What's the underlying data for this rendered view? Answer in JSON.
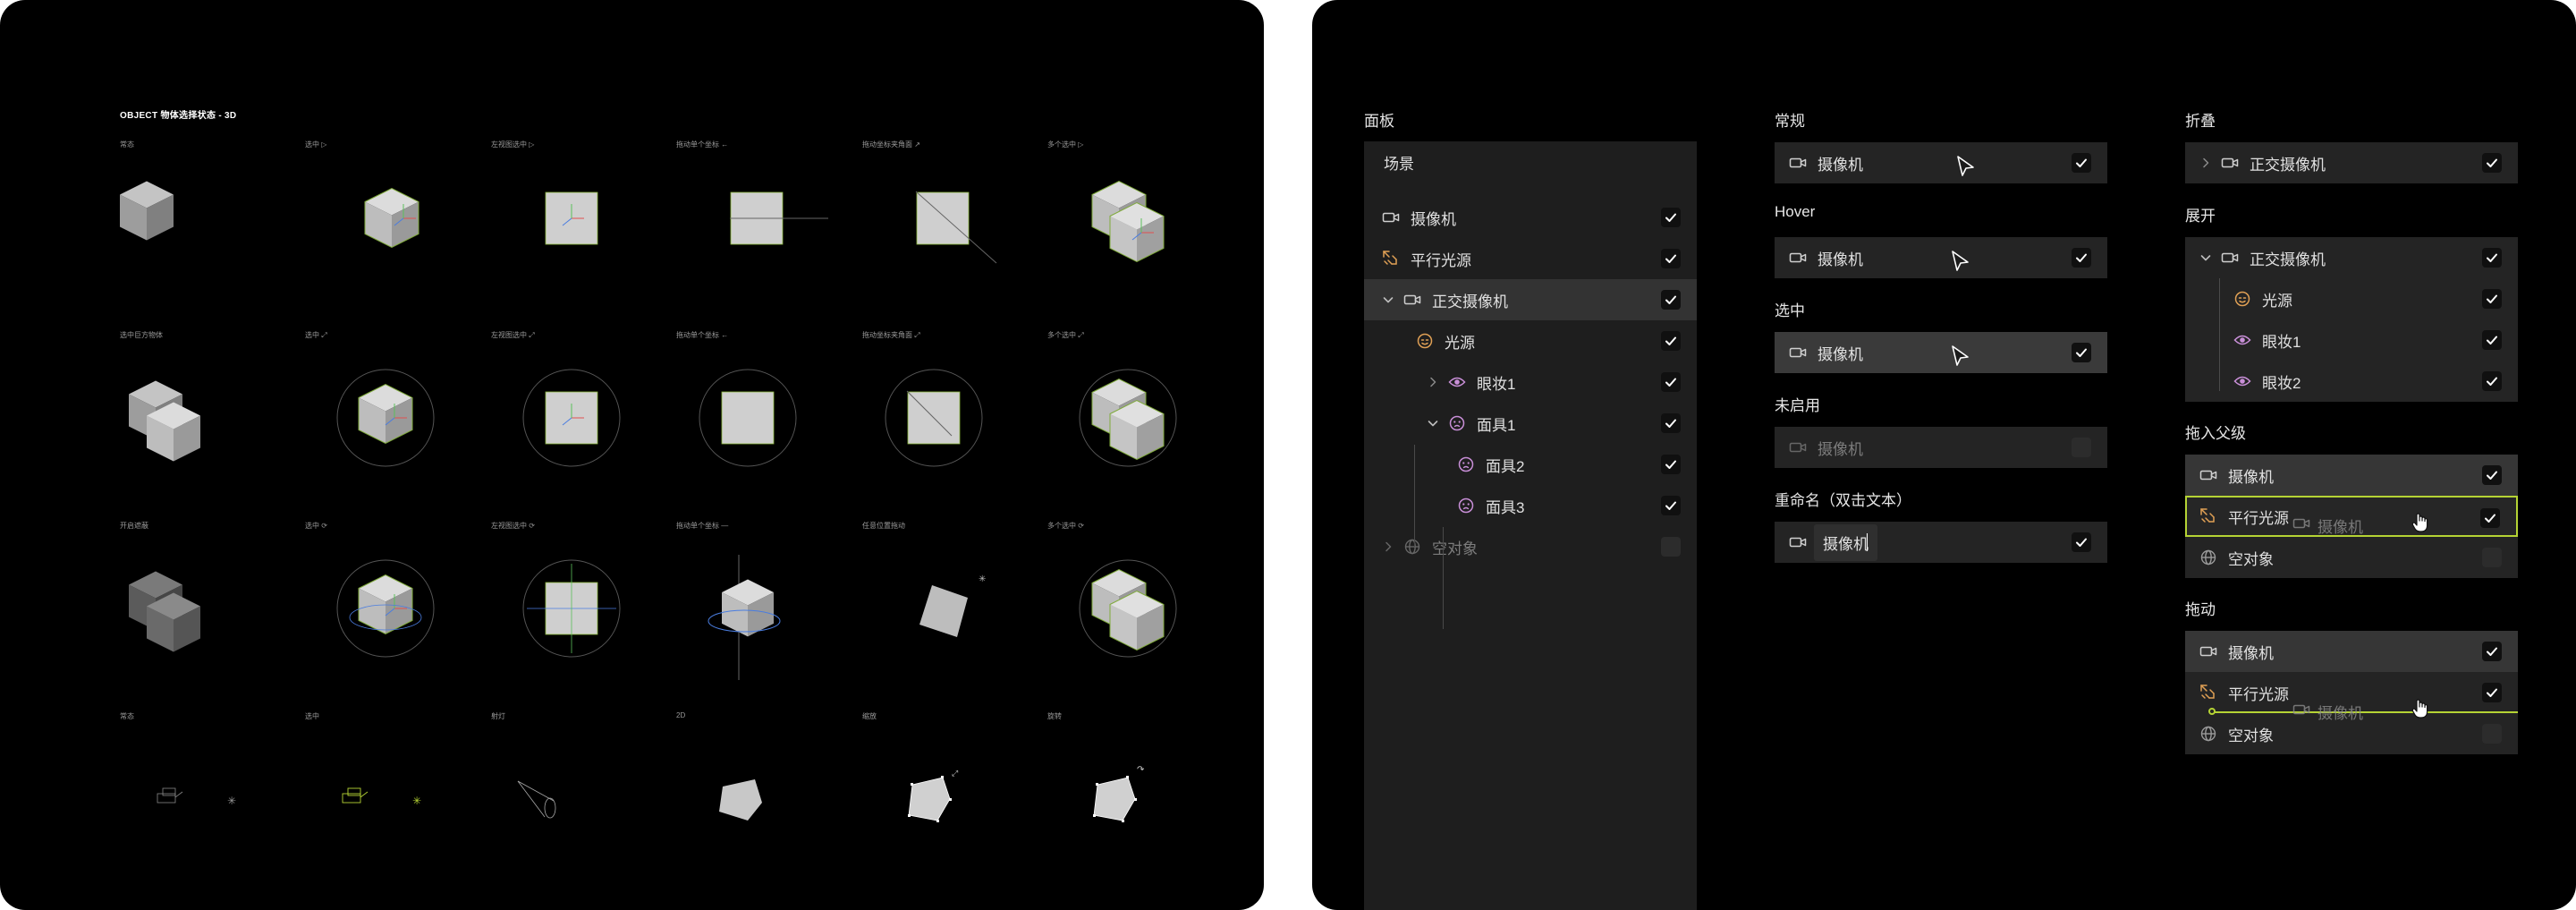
{
  "left": {
    "title": "OBJECT 物体选择状态 - 3D",
    "rows": [
      [
        "常态",
        "选中 ▷",
        "左视图选中 ▷",
        "拖动单个坐标 ←",
        "拖动坐标夹角面 ↗",
        "多个选中 ▷"
      ],
      [
        "选中巨方物体",
        "选中 ⤢",
        "左视图选中 ⤢",
        "拖动单个坐标 ←",
        "拖动坐标夹角面 ⤢",
        "多个选中 ⤢"
      ],
      [
        "开启遮蔽",
        "选中 ⟳",
        "左视图选中 ⟳",
        "拖动单个坐标 —",
        "任意位置拖动",
        "多个选中 ⟳"
      ],
      [
        "常态",
        "选中",
        "射灯",
        "2D",
        "缩放",
        "旋转"
      ]
    ]
  },
  "right": {
    "colors": {
      "accent": "#b5d334",
      "panel": "#1e1e1e",
      "row_selected": "#333333",
      "warm_icon": "#e0a055",
      "purple_icon": "#c98fd8"
    },
    "panel_section": {
      "title": "面板",
      "header": "场景",
      "items": [
        {
          "label": "摄像机",
          "icon": "camera-icon",
          "checked": true
        },
        {
          "label": "平行光源",
          "icon": "directional-light-icon",
          "checked": true
        },
        {
          "label": "正交摄像机",
          "icon": "camera-icon",
          "checked": true,
          "expanded": true
        },
        {
          "label": "光源",
          "icon": "light-face-icon",
          "checked": true
        },
        {
          "label": "眼妆1",
          "icon": "eye-icon",
          "checked": true
        },
        {
          "label": "面具1",
          "icon": "mask-icon",
          "checked": true,
          "expanded": true
        },
        {
          "label": "面具2",
          "icon": "mask-icon",
          "checked": true
        },
        {
          "label": "面具3",
          "icon": "mask-icon",
          "checked": true
        },
        {
          "label": "空对象",
          "icon": "globe-icon",
          "checked": false
        }
      ]
    },
    "states": {
      "normal": {
        "title": "常规",
        "label": "摄像机"
      },
      "hover": {
        "title": "Hover",
        "label": "摄像机"
      },
      "selected": {
        "title": "选中",
        "label": "摄像机"
      },
      "disabled": {
        "title": "未启用",
        "label": "摄像机"
      },
      "rename": {
        "title": "重命名（双击文本）",
        "label": "摄像机"
      }
    },
    "collapse": {
      "title": "折叠",
      "label": "正交摄像机"
    },
    "expand": {
      "title": "展开",
      "parent": "正交摄像机",
      "children": [
        {
          "label": "光源",
          "icon": "light-face-icon"
        },
        {
          "label": "眼妆1",
          "icon": "eye-icon"
        },
        {
          "label": "眼妆2",
          "icon": "eye-icon"
        }
      ]
    },
    "drag_into_parent": {
      "title": "拖入父级",
      "items": [
        "摄像机",
        "平行光源",
        "空对象"
      ],
      "ghost": "摄像机"
    },
    "drag": {
      "title": "拖动",
      "items": [
        "摄像机",
        "平行光源",
        "空对象"
      ],
      "ghost": "摄像机"
    }
  }
}
